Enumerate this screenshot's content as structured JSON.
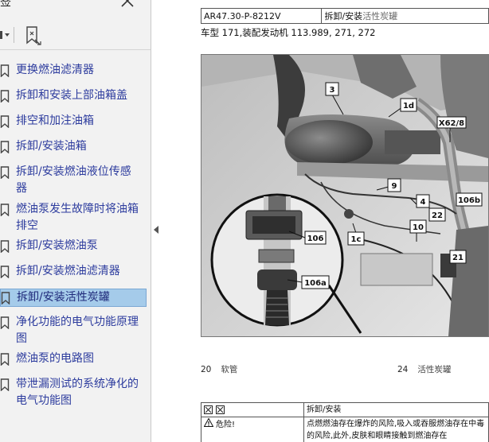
{
  "bookmarks_panel": {
    "title": "签",
    "items": [
      {
        "label": "更换燃油滤清器",
        "selected": false
      },
      {
        "label": "拆卸和安装上部油箱盖",
        "selected": false
      },
      {
        "label": "排空和加注油箱",
        "selected": false
      },
      {
        "label": "拆卸/安装油箱",
        "selected": false
      },
      {
        "label": "拆卸/安装燃油液位传感器",
        "selected": false
      },
      {
        "label": "燃油泵发生故障时将油箱排空",
        "selected": false
      },
      {
        "label": "拆卸/安装燃油泵",
        "selected": false
      },
      {
        "label": "拆卸/安装燃油滤清器",
        "selected": false
      },
      {
        "label": "拆卸/安装活性炭罐",
        "selected": true
      },
      {
        "label": "净化功能的电气功能原理图",
        "selected": false
      },
      {
        "label": "燃油泵的电路图",
        "selected": false
      },
      {
        "label": "带泄漏测试的系统净化的电气功能图",
        "selected": false
      }
    ],
    "icons": {
      "close": "close-icon",
      "options": "options-dropdown-icon",
      "expand": "expand-bookmark-icon",
      "bookmark": "bookmark-icon"
    },
    "colors": {
      "link": "#2d3c9e",
      "selected_bg": "#a5cbea"
    }
  },
  "document": {
    "header": {
      "code": "AR47.30-P-8212V",
      "title_main": "拆卸/安装",
      "title_grey": "活性炭罐"
    },
    "model_line": "车型  171,装配发动机 113.989, 271, 272",
    "figure": {
      "callouts": [
        "3",
        "1d",
        "X62/8",
        "9",
        "4",
        "106b",
        "22",
        "10",
        "21",
        "1c",
        "106",
        "106a"
      ]
    },
    "legend": [
      {
        "num": "20",
        "text": "软管"
      },
      {
        "num": "24",
        "text": "活性炭罐"
      }
    ],
    "steps": {
      "header_label": "拆卸/安装",
      "danger_label": "危险!",
      "danger_text": "点燃燃油存在爆炸的风险,吸入或吞服燃油存在中毒的风险,此外,皮肤和眼睛接触到燃油存在"
    }
  }
}
